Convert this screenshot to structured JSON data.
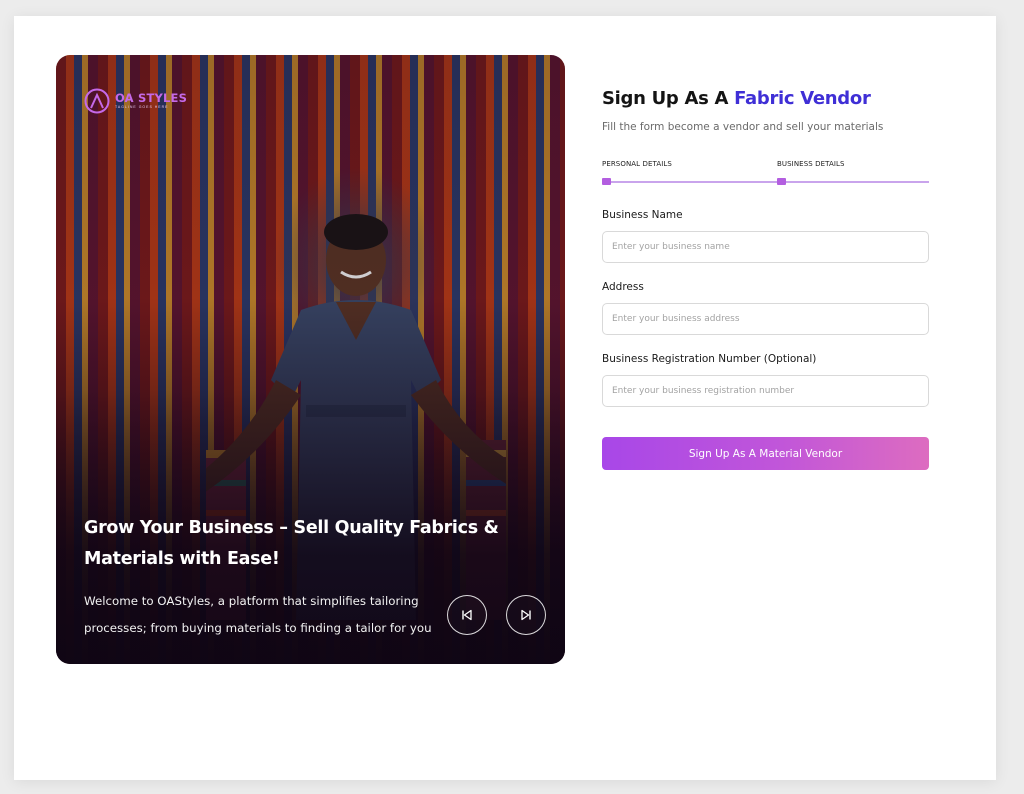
{
  "brand": {
    "name": "OA STYLES",
    "tagline": "TAGLINE GOES HERE",
    "color": "#c569e8"
  },
  "hero": {
    "title": "Grow Your Business – Sell Quality Fabrics & Materials with Ease!",
    "description": "Welcome to OAStyles, a platform that simplifies tailoring processes; from buying materials to finding a tailor for you",
    "prev_icon": "skip-previous-icon",
    "next_icon": "skip-next-icon"
  },
  "form": {
    "title_prefix": "Sign Up As A ",
    "title_accent": "Fabric Vendor",
    "subtitle": "Fill the form become a vendor and sell your materials",
    "steps": [
      {
        "label": "PERSONAL DETAILS"
      },
      {
        "label": "BUSINESS DETAILS"
      }
    ],
    "fields": [
      {
        "label": "Business Name",
        "placeholder": "Enter your business name",
        "value": ""
      },
      {
        "label": "Address",
        "placeholder": "Enter your business address",
        "value": ""
      },
      {
        "label": "Business Registration Number (Optional)",
        "placeholder": "Enter your business registration number",
        "value": ""
      }
    ],
    "submit_label": "Sign Up As A Material Vendor"
  },
  "colors": {
    "accent_text": "#3f2fd6",
    "button_gradient_start": "#a847e8",
    "button_gradient_end": "#dd6cc0",
    "step_indicator": "#b35ee0"
  }
}
